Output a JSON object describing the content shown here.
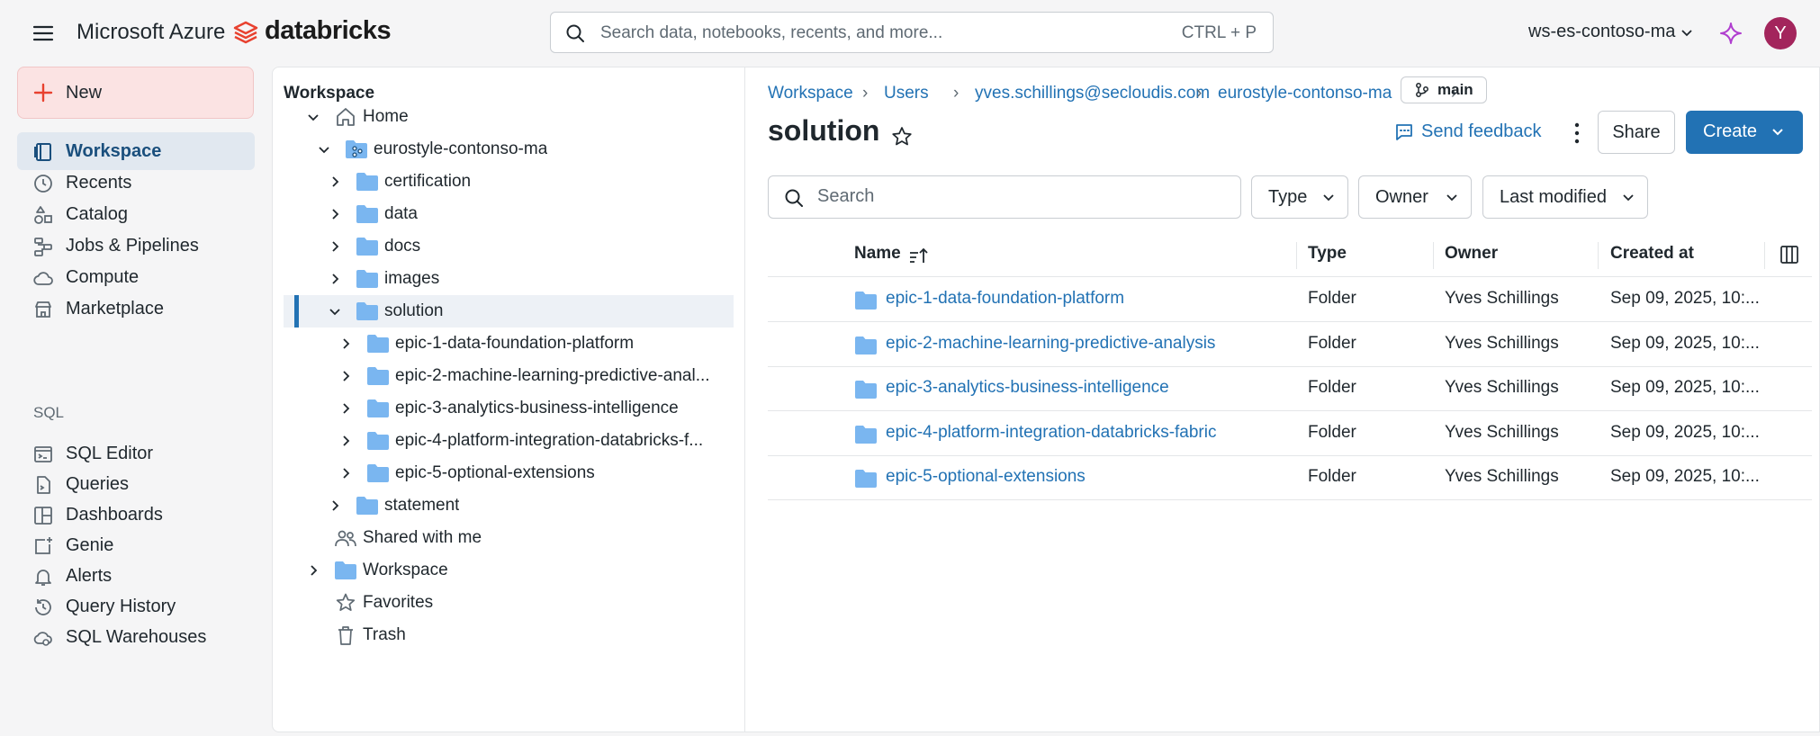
{
  "topbar": {
    "azure_label": "Microsoft Azure",
    "brand_label": "databricks",
    "search_placeholder": "Search data, notebooks, recents, and more...",
    "search_shortcut": "CTRL + P",
    "workspace_name": "ws-es-contoso-ma",
    "avatar_initial": "Y"
  },
  "leftnav": {
    "new_label": "New",
    "items": [
      {
        "label": "Workspace"
      },
      {
        "label": "Recents"
      },
      {
        "label": "Catalog"
      },
      {
        "label": "Jobs & Pipelines"
      },
      {
        "label": "Compute"
      },
      {
        "label": "Marketplace"
      }
    ],
    "sql_section_label": "SQL",
    "sql_items": [
      {
        "label": "SQL Editor"
      },
      {
        "label": "Queries"
      },
      {
        "label": "Dashboards"
      },
      {
        "label": "Genie"
      },
      {
        "label": "Alerts"
      },
      {
        "label": "Query History"
      },
      {
        "label": "SQL Warehouses"
      }
    ]
  },
  "tree": {
    "title": "Workspace",
    "items": [
      {
        "label": "Home"
      },
      {
        "label": "eurostyle-contonso-ma"
      },
      {
        "label": "certification"
      },
      {
        "label": "data"
      },
      {
        "label": "docs"
      },
      {
        "label": "images"
      },
      {
        "label": "solution"
      },
      {
        "label": "epic-1-data-foundation-platform"
      },
      {
        "label": "epic-2-machine-learning-predictive-anal..."
      },
      {
        "label": "epic-3-analytics-business-intelligence"
      },
      {
        "label": "epic-4-platform-integration-databricks-f..."
      },
      {
        "label": "epic-5-optional-extensions"
      },
      {
        "label": "statement"
      },
      {
        "label": "Shared with me"
      },
      {
        "label": "Workspace"
      },
      {
        "label": "Favorites"
      },
      {
        "label": "Trash"
      }
    ]
  },
  "content": {
    "breadcrumbs": [
      "Workspace",
      "Users",
      "yves.schillings@secloudis.com",
      "eurostyle-contonso-ma"
    ],
    "branch": "main",
    "title": "solution",
    "feedback_label": "Send feedback",
    "share_label": "Share",
    "create_label": "Create",
    "search_placeholder": "Search",
    "filters": {
      "type": "Type",
      "owner": "Owner",
      "last_modified": "Last modified"
    },
    "columns": {
      "name": "Name",
      "type": "Type",
      "owner": "Owner",
      "created": "Created at"
    },
    "rows": [
      {
        "name": "epic-1-data-foundation-platform",
        "type": "Folder",
        "owner": "Yves Schillings",
        "created": "Sep 09, 2025, 10:..."
      },
      {
        "name": "epic-2-machine-learning-predictive-analysis",
        "type": "Folder",
        "owner": "Yves Schillings",
        "created": "Sep 09, 2025, 10:..."
      },
      {
        "name": "epic-3-analytics-business-intelligence",
        "type": "Folder",
        "owner": "Yves Schillings",
        "created": "Sep 09, 2025, 10:..."
      },
      {
        "name": "epic-4-platform-integration-databricks-fabric",
        "type": "Folder",
        "owner": "Yves Schillings",
        "created": "Sep 09, 2025, 10:..."
      },
      {
        "name": "epic-5-optional-extensions",
        "type": "Folder",
        "owner": "Yves Schillings",
        "created": "Sep 09, 2025, 10:..."
      }
    ]
  },
  "colors": {
    "accent": "#2272b4",
    "folder": "#7ab6f0",
    "new_button_bg": "#fbe3e3",
    "avatar_bg": "#a3255c",
    "brand_red": "#e8412f"
  }
}
